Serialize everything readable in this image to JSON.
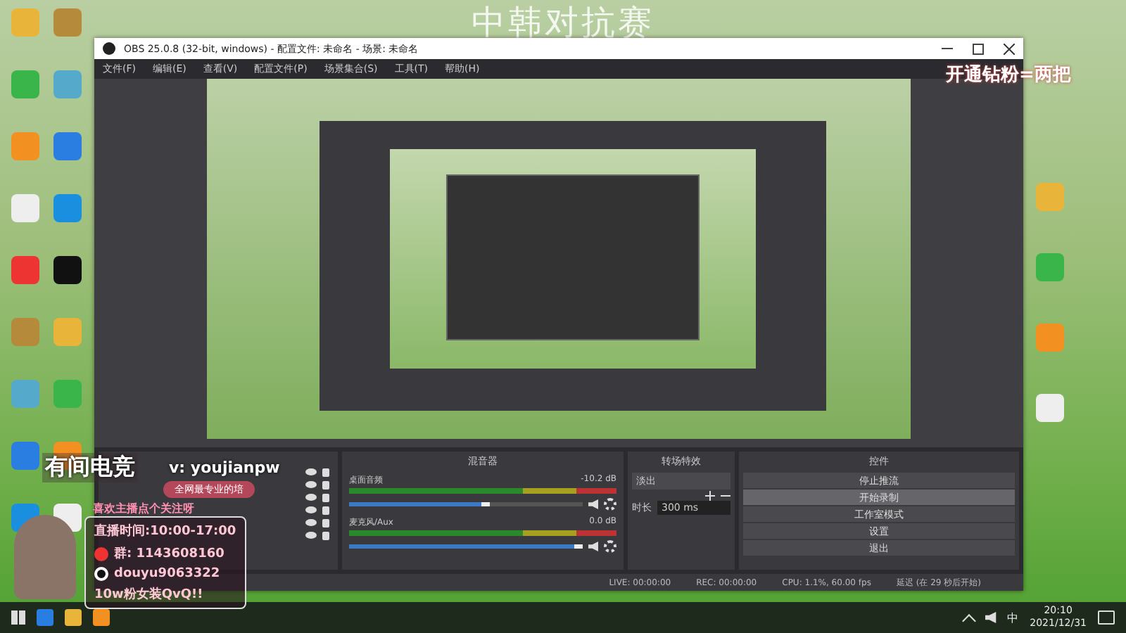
{
  "stream_overlay": {
    "title": "中韩对抗赛",
    "notice": "开通钻粉=两把"
  },
  "obs_window": {
    "title": "OBS 25.0.8 (32-bit, windows) - 配置文件: 未命名 - 场景: 未命名",
    "menu": [
      "文件(F)",
      "编辑(E)",
      "查看(V)",
      "配置文件(P)",
      "场景集合(S)",
      "工具(T)",
      "帮助(H)"
    ],
    "mixer": {
      "title": "混音器",
      "channels": [
        {
          "name": "桌面音频",
          "reading": "-10.2 dB",
          "level": 0.6
        },
        {
          "name": "麦克风/Aux",
          "reading": "0.0 dB",
          "level": 1.0
        }
      ]
    },
    "transitions": {
      "title": "转场特效",
      "transition": "淡出",
      "duration_label": "时长",
      "duration": "300 ms"
    },
    "controls": {
      "title": "控件",
      "buttons": [
        {
          "label": "停止推流",
          "selected": false
        },
        {
          "label": "开始录制",
          "selected": true
        },
        {
          "label": "工作室模式",
          "selected": false
        },
        {
          "label": "设置",
          "selected": false
        },
        {
          "label": "退出",
          "selected": false
        }
      ]
    },
    "status_bar": [
      "LIVE: 00:00:00",
      "REC: 00:00:00",
      "CPU: 1.1%, 60.00 fps",
      "延迟 (在 29 秒后开始)"
    ]
  },
  "streamer_card": {
    "brand": "有间电竞",
    "contact": "v: youjianpw",
    "tagline": "全网最专业的培",
    "follow": "喜欢主播点个关注呀",
    "hours": "直播时间:10:00-17:00",
    "group": "群: 1143608160",
    "douyin": "douyu9063322",
    "goal": "10w粉女装QvQ!!"
  },
  "taskbar": {
    "ime": "中",
    "time": "20:10",
    "date": "2021/12/31"
  }
}
